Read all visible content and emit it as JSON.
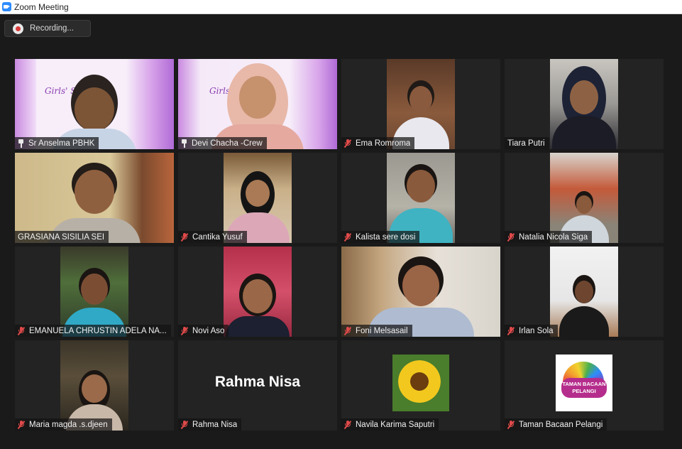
{
  "window": {
    "title": "Zoom Meeting"
  },
  "recording": {
    "label": "Recording..."
  },
  "colors": {
    "active_speaker_outline": "#e8e36b",
    "muted_mic": "#e04a4a",
    "zoom_blue": "#2d8cff"
  },
  "participants": [
    {
      "name": "Sr Anselma PBHK",
      "status": "pinned",
      "banner": "Girls' Sch      eamp"
    },
    {
      "name": "Devi Chacha -Crew",
      "status": "pinned",
      "active": true,
      "banner": "Girls' S       eamp"
    },
    {
      "name": "Ema Romroma",
      "status": "muted"
    },
    {
      "name": "Tiara Putri",
      "status": "none"
    },
    {
      "name": "GRASIANA SISILIA SEI",
      "status": "none"
    },
    {
      "name": "Cantika Yusuf",
      "status": "muted"
    },
    {
      "name": "Kalista sere dosi",
      "status": "muted"
    },
    {
      "name": "Natalia Nicola Siga",
      "status": "muted"
    },
    {
      "name": "EMANUELA CHRUSTIN ADELA NA...",
      "status": "muted"
    },
    {
      "name": "Novi Aso",
      "status": "muted"
    },
    {
      "name": "Foni Melsasail",
      "status": "muted"
    },
    {
      "name": "Irlan Sola",
      "status": "muted"
    },
    {
      "name": "Maria magda .s.djeen",
      "status": "muted"
    },
    {
      "name": "Rahma Nisa",
      "status": "muted",
      "video_off_name": "Rahma Nisa"
    },
    {
      "name": "Navila Karima Saputri",
      "status": "muted"
    },
    {
      "name": "Taman Bacaan Pelangi",
      "status": "muted",
      "logo_text": "TAMAN BACAAN PELANGI"
    }
  ]
}
